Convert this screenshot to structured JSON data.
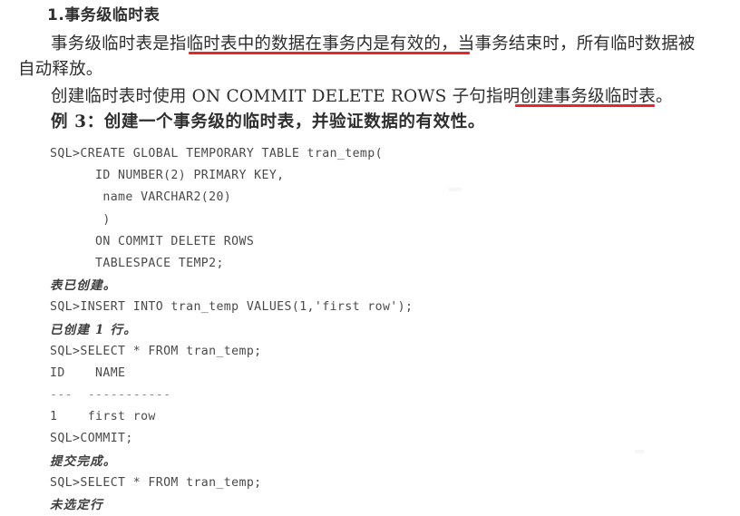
{
  "document": {
    "heading": "1.事务级临时表",
    "paragraphs": [
      "事务级临时表是指临时表中的数据在事务内是有效的，当事务结束时，所有临时数据被",
      "自动释放。",
      "创建临时表时使用 ON COMMIT DELETE ROWS 子句指明创建事务级临时表。",
      "例 3：创建一个事务级的临时表，并验证数据的有效性。"
    ],
    "highlights": [
      {
        "name": "underline-1",
        "text": "临时表中的数据在事务内是有效的",
        "color": "#e8262a"
      },
      {
        "name": "underline-2",
        "text": "创建事务级临时表",
        "color": "#e8262a"
      }
    ],
    "code_block": {
      "lines": [
        {
          "text": "SQL>CREATE GLOBAL TEMPORARY TABLE tran_temp(",
          "kind": "sql"
        },
        {
          "text": "      ID NUMBER(2) PRIMARY KEY,",
          "kind": "sql"
        },
        {
          "text": "       name VARCHAR2(20)",
          "kind": "sql"
        },
        {
          "text": "       )",
          "kind": "sql"
        },
        {
          "text": "      ON COMMIT DELETE ROWS",
          "kind": "sql"
        },
        {
          "text": "      TABLESPACE TEMP2;",
          "kind": "sql"
        },
        {
          "text": "表已创建。",
          "kind": "cn"
        },
        {
          "text": "SQL>INSERT INTO tran_temp VALUES(1,'first row');",
          "kind": "sql"
        },
        {
          "text": "已创建 1 行。",
          "kind": "cn"
        },
        {
          "text": "SQL>SELECT * FROM tran_temp;",
          "kind": "sql"
        },
        {
          "text": "ID    NAME",
          "kind": "sql"
        },
        {
          "text": "---  -----------",
          "kind": "rule"
        },
        {
          "text": "1    first row",
          "kind": "sql"
        },
        {
          "text": "SQL>COMMIT;",
          "kind": "sql"
        },
        {
          "text": "提交完成。",
          "kind": "cn"
        },
        {
          "text": "SQL>SELECT * FROM tran_temp;",
          "kind": "sql"
        },
        {
          "text": "未选定行",
          "kind": "cn"
        }
      ]
    }
  }
}
